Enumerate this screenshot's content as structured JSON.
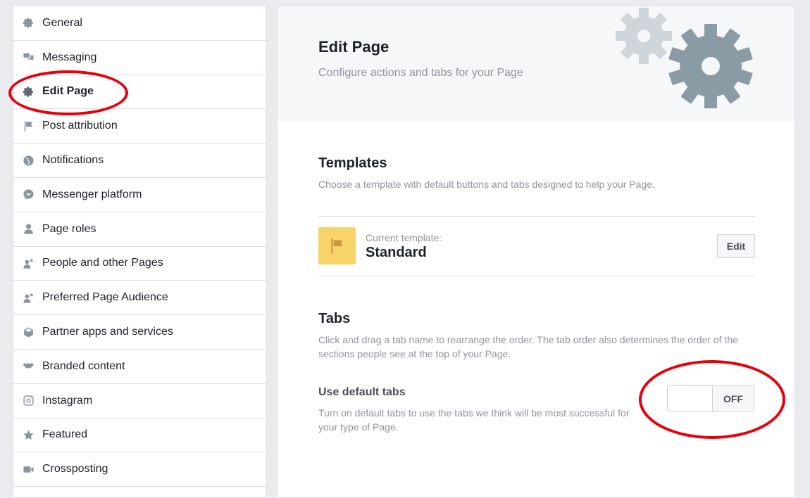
{
  "sidebar": {
    "items": [
      {
        "label": "General",
        "icon": "gear-icon"
      },
      {
        "label": "Messaging",
        "icon": "chat-bubbles-icon"
      },
      {
        "label": "Edit Page",
        "icon": "gear-icon",
        "active": true
      },
      {
        "label": "Post attribution",
        "icon": "flag-icon"
      },
      {
        "label": "Notifications",
        "icon": "globe-icon"
      },
      {
        "label": "Messenger platform",
        "icon": "messenger-icon"
      },
      {
        "label": "Page roles",
        "icon": "person-icon"
      },
      {
        "label": "People and other Pages",
        "icon": "person-star-icon"
      },
      {
        "label": "Preferred Page Audience",
        "icon": "person-star-icon"
      },
      {
        "label": "Partner apps and services",
        "icon": "cube-icon"
      },
      {
        "label": "Branded content",
        "icon": "handshake-icon"
      },
      {
        "label": "Instagram",
        "icon": "instagram-icon"
      },
      {
        "label": "Featured",
        "icon": "star-icon"
      },
      {
        "label": "Crossposting",
        "icon": "video-icon"
      }
    ]
  },
  "hero": {
    "title": "Edit Page",
    "subtitle": "Configure actions and tabs for your Page"
  },
  "templates": {
    "title": "Templates",
    "description": "Choose a template with default buttons and tabs designed to help your Page.",
    "current_caption": "Current template:",
    "current_name": "Standard",
    "edit_label": "Edit"
  },
  "tabs": {
    "title": "Tabs",
    "description": "Click and drag a tab name to rearrange the order. The tab order also determines the order of the sections people see at the top of your Page.",
    "default_label": "Use default tabs",
    "default_description": "Turn on default tabs to use the tabs we think will be most successful for your type of Page.",
    "toggle_state": "OFF"
  },
  "colors": {
    "annotation": "#e8000b",
    "template_icon_bg": "#f7d36a",
    "gear_dark": "#8b9ba5",
    "gear_light": "#ced5db"
  }
}
